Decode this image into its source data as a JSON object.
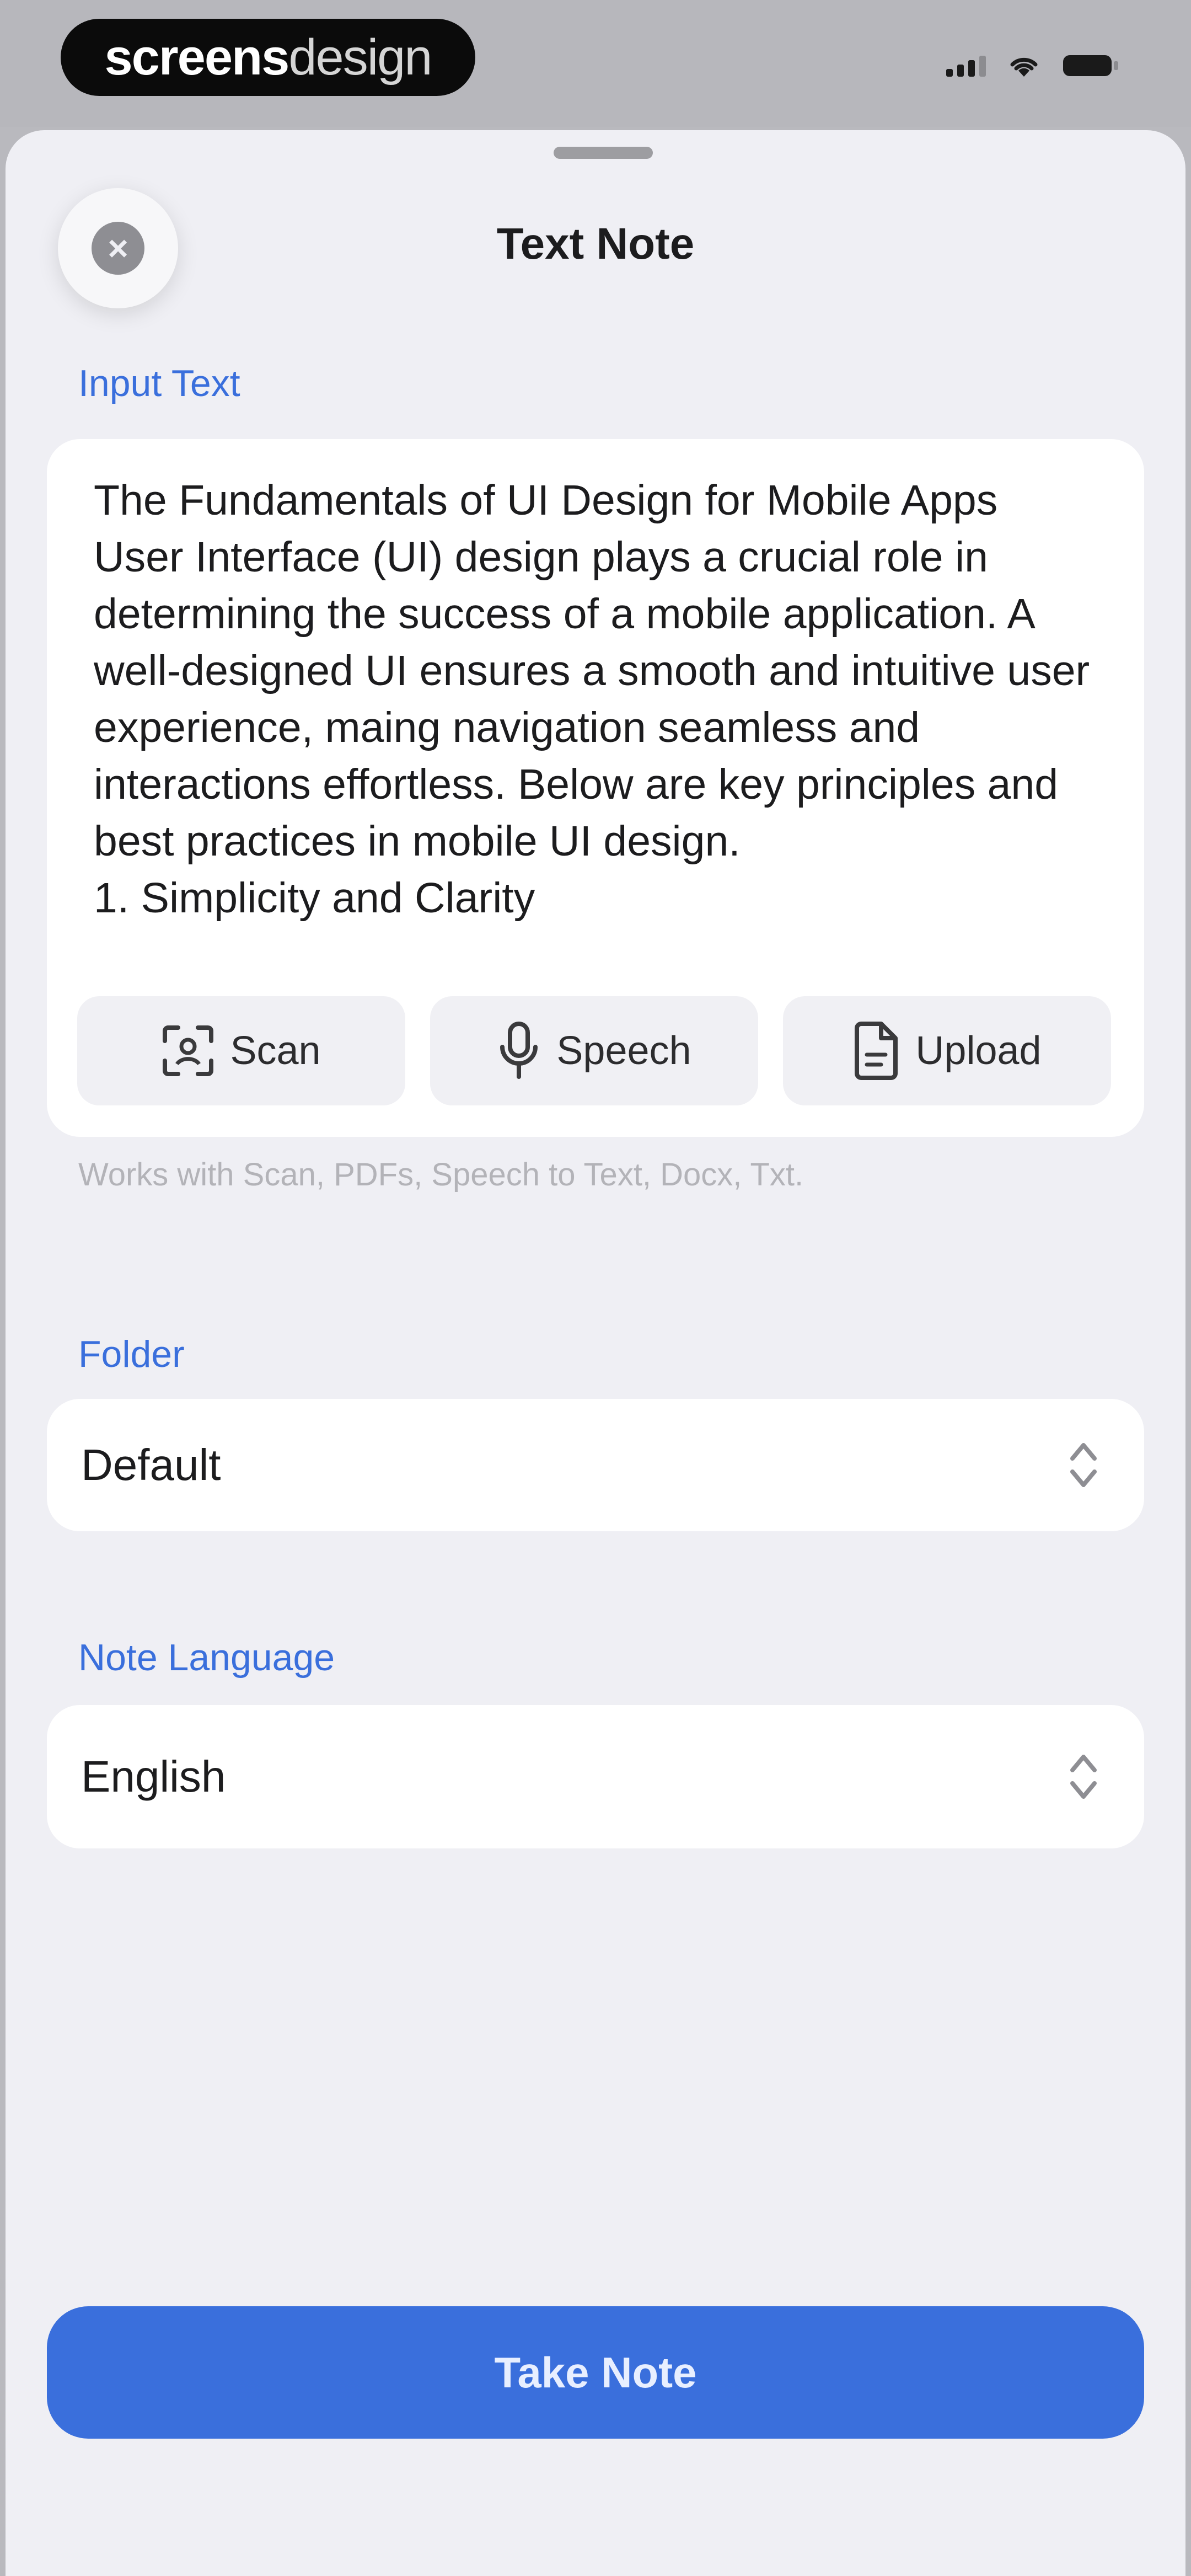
{
  "status_bar": {
    "brand_bold": "screens",
    "brand_light": "design",
    "icons": [
      "cellular-signal-icon",
      "wifi-icon",
      "battery-icon"
    ]
  },
  "sheet": {
    "title": "Text Note",
    "close_icon": "close-icon"
  },
  "input_section": {
    "label": "Input Text",
    "text": "The Fundamentals of UI Design for Mobile Apps\nUser Interface (UI) design plays a crucial role in determining the success of a mobile application. A well-designed UI ensures a smooth and intuitive user experience, maing navigation seamless and interactions effortless. Below are key principles and best practices in mobile UI design.\n1. Simplicity and Clarity",
    "tools": [
      {
        "label": "Scan",
        "icon": "scan-icon"
      },
      {
        "label": "Speech",
        "icon": "microphone-icon"
      },
      {
        "label": "Upload",
        "icon": "document-icon"
      }
    ],
    "hint": "Works with Scan, PDFs, Speech to Text, Docx, Txt."
  },
  "folder": {
    "label": "Folder",
    "value": "Default"
  },
  "language": {
    "label": "Note Language",
    "value": "English"
  },
  "primary_action": {
    "label": "Take Note"
  },
  "colors": {
    "accent": "#3a6fdc",
    "sheet_background": "#efeff4",
    "card_background": "#ffffff"
  }
}
